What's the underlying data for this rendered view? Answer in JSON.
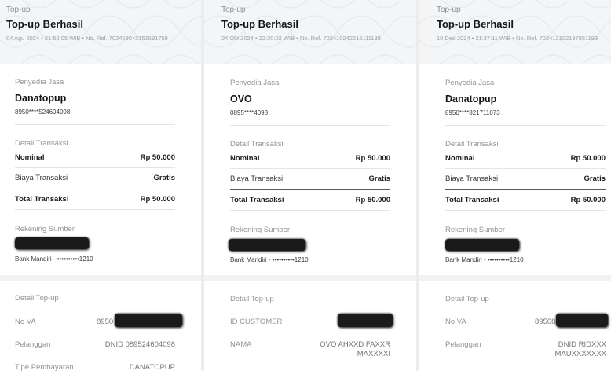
{
  "receipts": [
    {
      "header_tag": "Top-up",
      "header_title": "Top-up Berhasil",
      "header_meta": "04 Agu 2024 • 21:52:05 WIB • No. Ref. 702408042151591758",
      "provider_label": "Penyedia Jasa",
      "provider_name": "Danatopup",
      "provider_number": "8950****524604098",
      "detail_label": "Detail Transaksi",
      "nominal_label": "Nominal",
      "nominal_value": "Rp 50.000",
      "fee_label": "Biaya Transaksi",
      "fee_value": "Gratis",
      "total_label": "Total Transaksi",
      "total_value": "Rp 50.000",
      "source_label": "Rekening Sumber",
      "source_bank": "Bank Mandiri - ••••••••••1210",
      "topup_label": "Detail Top-up",
      "rows": [
        {
          "label": "No VA",
          "value": "8950"
        },
        {
          "label": "Pelanggan",
          "value": "DNID 089524604098"
        },
        {
          "label": "Tipe Pembayaran",
          "value": "DANATOPUP"
        }
      ]
    },
    {
      "header_tag": "Top-up",
      "header_title": "Top-up Berhasil",
      "header_meta": "24 Okt 2024 • 22:20:02 WIB • No. Ref. 702410242215111135",
      "provider_label": "Penyedia Jasa",
      "provider_name": "OVO",
      "provider_number": "0895****4098",
      "detail_label": "Detail Transaksi",
      "nominal_label": "Nominal",
      "nominal_value": "Rp 50.000",
      "fee_label": "Biaya Transaksi",
      "fee_value": "Gratis",
      "total_label": "Total Transaksi",
      "total_value": "Rp 50.000",
      "source_label": "Rekening Sumber",
      "source_bank": "Bank Mandiri - ••••••••••1210",
      "topup_label": "Detail Top-up",
      "rows": [
        {
          "label": "ID CUSTOMER",
          "value": ""
        },
        {
          "label": "NAMA",
          "value": "OVO AHXXD FAXXR",
          "value2": "MAXXXXI"
        }
      ]
    },
    {
      "header_tag": "Top-up",
      "header_title": "Top-up Berhasil",
      "header_meta": "10 Des 2024 • 21:37:11 WIB • No. Ref. 702412102137051193",
      "provider_label": "Penyedia Jasa",
      "provider_name": "Danatopup",
      "provider_number": "8950****821711073",
      "detail_label": "Detail Transaksi",
      "nominal_label": "Nominal",
      "nominal_value": "Rp 50.000",
      "fee_label": "Biaya Transaksi",
      "fee_value": "Gratis",
      "total_label": "Total Transaksi",
      "total_value": "Rp 50.000",
      "source_label": "Rekening Sumber",
      "source_bank": "Bank Mandiri - ••••••••••1210",
      "topup_label": "Detail Top-up",
      "rows": [
        {
          "label": "No VA",
          "value": "89508"
        },
        {
          "label": "Pelanggan",
          "value": "DNID RIDXXX",
          "value2": "MAUXXXXXXX"
        }
      ]
    }
  ]
}
